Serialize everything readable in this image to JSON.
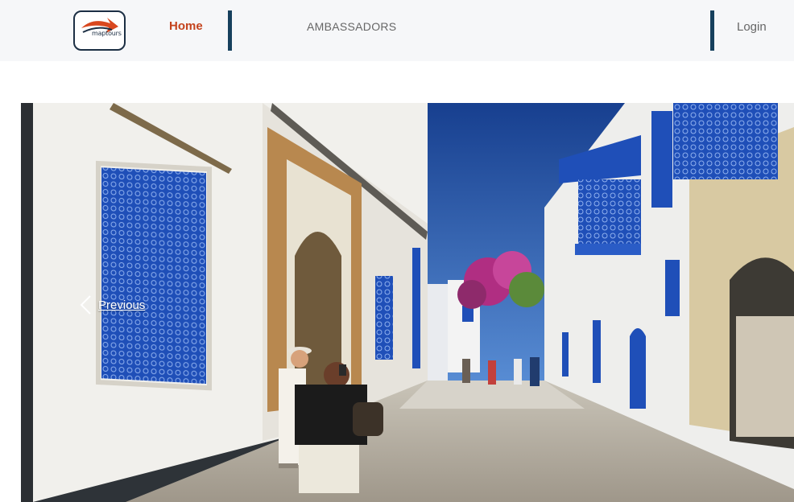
{
  "nav": {
    "logo_text": "maptours",
    "home_label": "Home",
    "ambassadors_label": "AMBASSADORS",
    "login_label": "Login"
  },
  "carousel": {
    "prev_label": "Previous"
  },
  "colors": {
    "accent": "#c4431d",
    "divider": "#16405d",
    "nav_bg": "#f6f7f9",
    "sky": "#1b4a9e",
    "shutter_blue": "#1f4fb8"
  }
}
